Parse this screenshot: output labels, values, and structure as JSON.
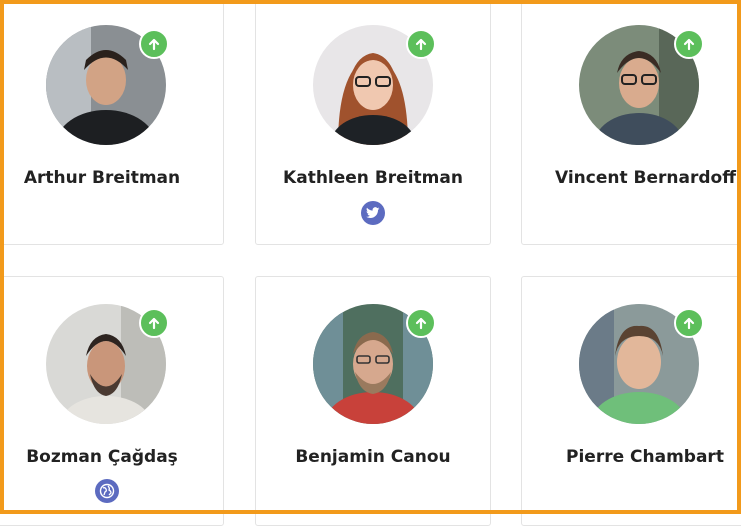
{
  "colors": {
    "accent_green": "#5cbf5b",
    "social_blue": "#5c6bc0",
    "frame_orange": "#f29a1b"
  },
  "people": [
    {
      "name": "Arthur Breitman",
      "badge_icon": "arrow-up-icon",
      "social_icon": null
    },
    {
      "name": "Kathleen Breitman",
      "badge_icon": "arrow-up-icon",
      "social_icon": "twitter-icon"
    },
    {
      "name": "Vincent Bernardoff",
      "badge_icon": "arrow-up-icon",
      "social_icon": null
    },
    {
      "name": "Bozman Çağdaş",
      "badge_icon": "arrow-up-icon",
      "social_icon": "globe-icon"
    },
    {
      "name": "Benjamin Canou",
      "badge_icon": "arrow-up-icon",
      "social_icon": null
    },
    {
      "name": "Pierre Chambart",
      "badge_icon": "arrow-up-icon",
      "social_icon": null
    }
  ]
}
